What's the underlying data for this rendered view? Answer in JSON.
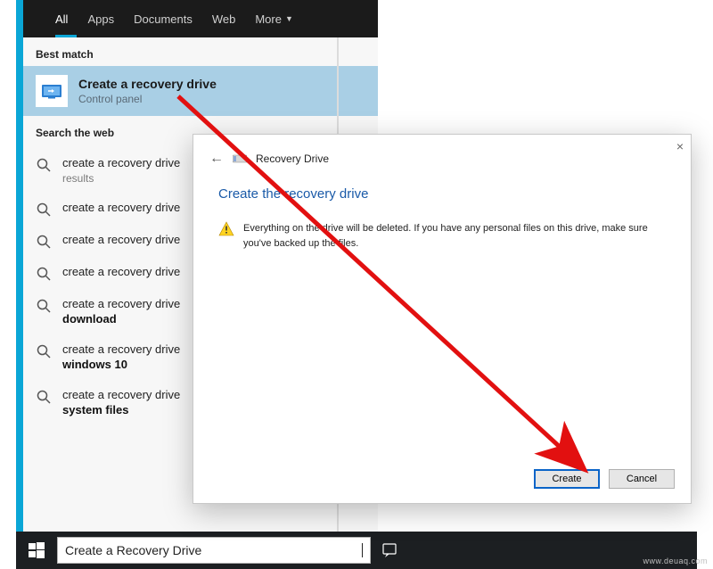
{
  "tabs": {
    "items": [
      "All",
      "Apps",
      "Documents",
      "Web",
      "More"
    ],
    "active_index": 0
  },
  "sections": {
    "best_match": "Best match",
    "search_web": "Search the web"
  },
  "best_match": {
    "title": "Create a recovery drive",
    "subtitle": "Control panel"
  },
  "web_results": [
    {
      "text": "create a recovery drive",
      "sub": "results",
      "bold": ""
    },
    {
      "text": "create a recovery drive",
      "sub": "",
      "bold": ""
    },
    {
      "text": "create a recovery drive",
      "sub": "",
      "bold": ""
    },
    {
      "text": "create a recovery drive",
      "sub": "",
      "bold": ""
    },
    {
      "text": "create a recovery drive",
      "sub": "",
      "bold": "download"
    },
    {
      "text": "create a recovery drive",
      "sub": "",
      "bold": "windows 10"
    },
    {
      "text": "create a recovery drive",
      "sub": "",
      "bold": "system files"
    }
  ],
  "search": {
    "value": "Create a Recovery Drive"
  },
  "dialog": {
    "header": "Recovery Drive",
    "title": "Create the recovery drive",
    "message": "Everything on the drive will be deleted. If you have any personal files on this drive, make sure you've backed up the files.",
    "primary": "Create",
    "secondary": "Cancel",
    "close": "×",
    "back": "←"
  },
  "watermark": "www.deuaq.com"
}
